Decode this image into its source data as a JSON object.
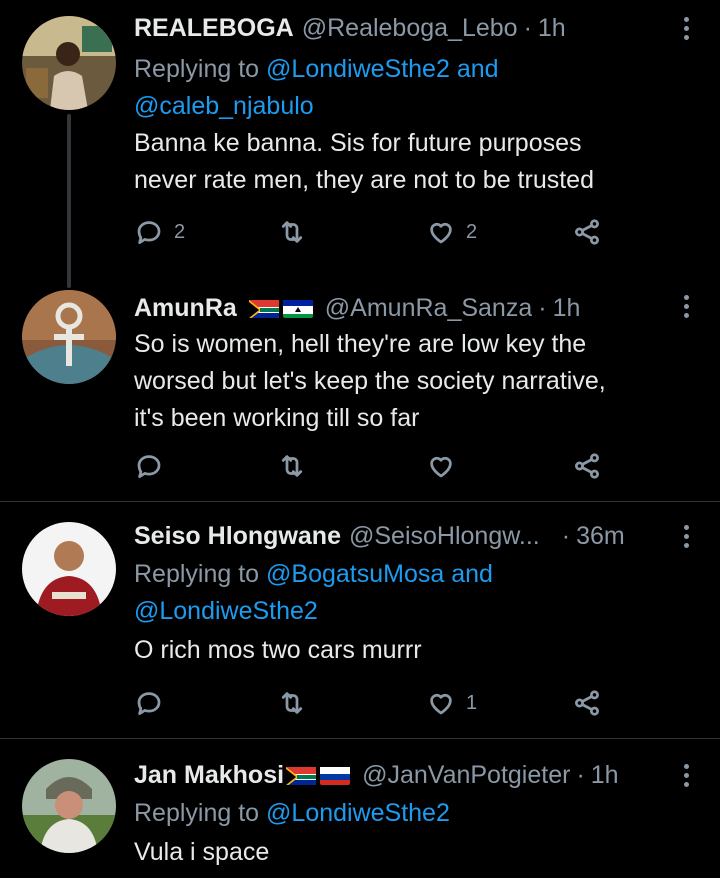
{
  "tweets": [
    {
      "name": "REALEBOGA",
      "handle": "@Realeboga_Lebo",
      "time": "1h",
      "flags": "",
      "replying_prefix": "Replying to",
      "replying_to_1": "@LondiweSthe2",
      "replying_and": "and",
      "replying_to_2": "@caleb_njabulo",
      "text_line_1": "Banna ke banna. Sis for future purposes",
      "text_line_2": "never rate men, they are not to be trusted",
      "replies": "2",
      "retweets": "",
      "likes": "2"
    },
    {
      "name": "AmunRa",
      "handle": "@AmunRa_Sanza",
      "time": "1h",
      "flags": [
        "south-africa",
        "lesotho"
      ],
      "text_line_1": "So is women, hell they're are low key the",
      "text_line_2": "worsed but let's keep the society narrative,",
      "text_line_3": "it's been working till so far",
      "replies": "",
      "retweets": "",
      "likes": ""
    },
    {
      "name": "Seiso Hlongwane",
      "handle": "@SeisoHlongw...",
      "time": "36m",
      "replying_prefix": "Replying to",
      "replying_to_1": "@BogatsuMosa",
      "replying_and": "and",
      "replying_to_2": "@LondiweSthe2",
      "text_line_1": "O rich mos two cars murrr",
      "replies": "",
      "retweets": "",
      "likes": "1"
    },
    {
      "name": "Jan Makhosi",
      "handle": "@JanVanPotgieter",
      "time": "1h",
      "flags": [
        "south-africa",
        "russia"
      ],
      "replying_prefix": "Replying to",
      "replying_to_1": "@LondiweSthe2",
      "text_line_1": "Vula i space"
    }
  ],
  "separator": "·",
  "icons": [
    "reply-icon",
    "retweet-icon",
    "like-icon",
    "share-icon",
    "more-icon"
  ],
  "colors": {
    "background": "#000000",
    "text": "#e7e9ea",
    "muted": "#8b98a5",
    "link": "#1d9bf0",
    "divider": "#2f3336"
  }
}
